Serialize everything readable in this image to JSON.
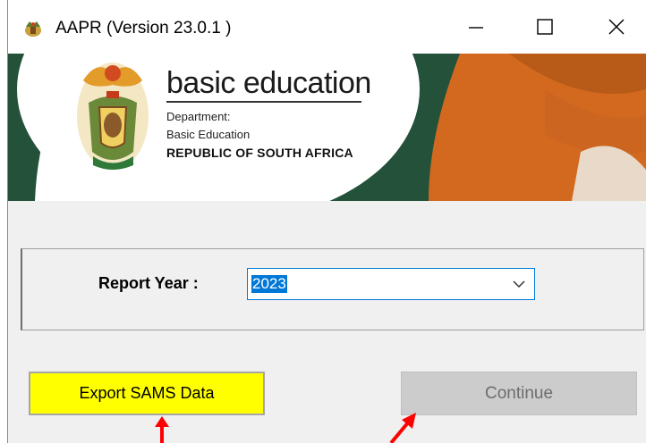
{
  "window": {
    "title": "AAPR (Version 23.0.1 )",
    "icons": {
      "app": "coat-of-arms-icon",
      "minimize": "minimize-icon",
      "maximize": "maximize-icon",
      "close": "close-icon"
    }
  },
  "banner": {
    "title": "basic education",
    "dept_line1": "Department:",
    "dept_line2": "Basic Education",
    "country": "REPUBLIC OF SOUTH AFRICA",
    "colors": {
      "green": "#23513a",
      "orange": "#d2691e"
    }
  },
  "form": {
    "report_year_label": "Report Year :",
    "report_year_value": "2023"
  },
  "buttons": {
    "export_label": "Export SAMS Data",
    "export_color": "#ffff00",
    "continue_label": "Continue"
  },
  "annotations": {
    "arrow_color": "#ff0000"
  }
}
